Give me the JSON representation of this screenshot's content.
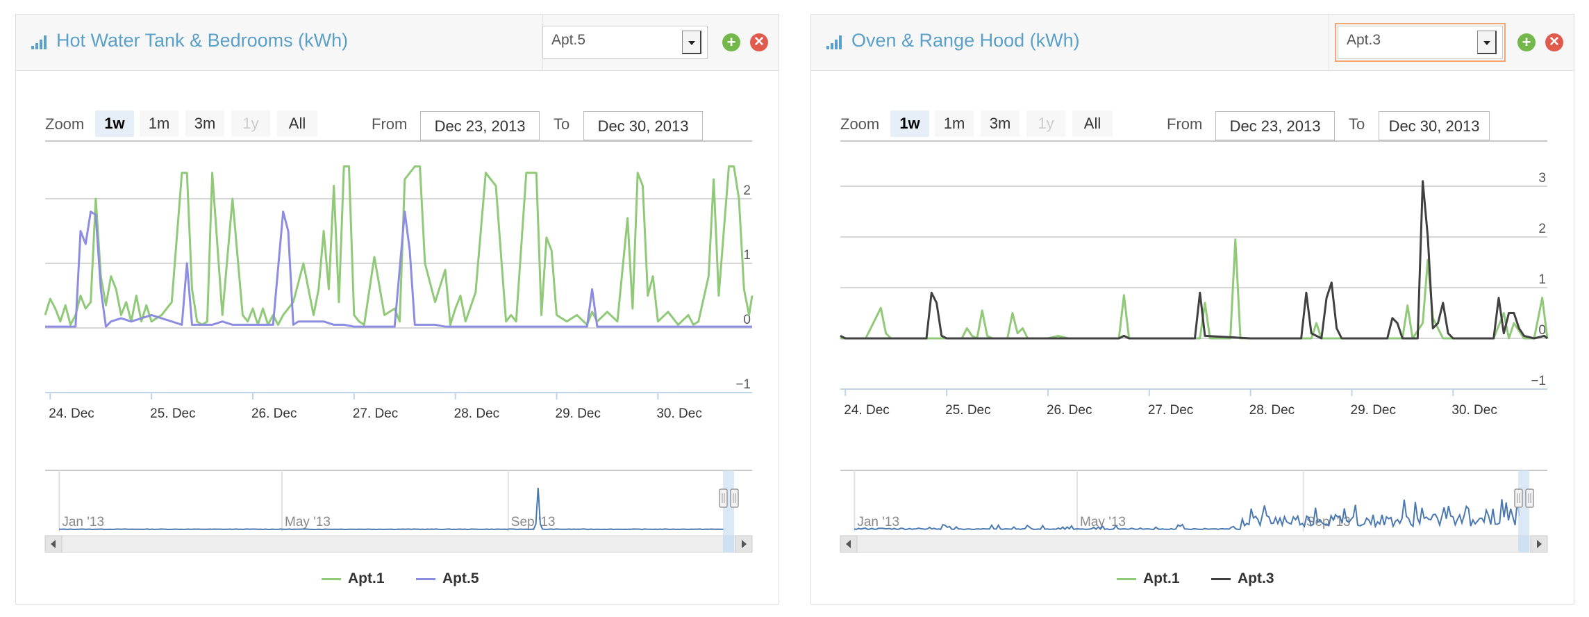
{
  "panels": [
    {
      "title": "Hot Water Tank & Bedrooms (kWh)",
      "apartment": "Apt.5",
      "zoom_label": "Zoom",
      "zoom_buttons": [
        "1w",
        "1m",
        "3m",
        "1y",
        "All"
      ],
      "zoom_active": "1w",
      "zoom_disabled": "1y",
      "from_label": "From",
      "from_date": "Dec 23, 2013",
      "to_label": "To",
      "to_date": "Dec 30, 2013"
    },
    {
      "title": "Oven & Range Hood (kWh)",
      "apartment": "Apt.3",
      "zoom_label": "Zoom",
      "zoom_buttons": [
        "1w",
        "1m",
        "3m",
        "1y",
        "All"
      ],
      "zoom_active": "1w",
      "zoom_disabled": "1y",
      "from_label": "From",
      "from_date": "Dec 23, 2013",
      "to_label": "To",
      "to_date": "Dec 30, 2013"
    }
  ],
  "chart_data": [
    {
      "type": "line",
      "x_unit": "days (Dec 2013)",
      "xlim": [
        23.95,
        30.93
      ],
      "ylim": [
        -1,
        3
      ],
      "yticks": [
        -1,
        0,
        1,
        2
      ],
      "xtick_labels": [
        "24. Dec",
        "25. Dec",
        "26. Dec",
        "27. Dec",
        "28. Dec",
        "29. Dec",
        "30. Dec"
      ],
      "xtick_values": [
        24,
        25,
        26,
        27,
        28,
        29,
        30
      ],
      "grid": true,
      "legend_position": "bottom-center",
      "series": [
        {
          "name": "Apt.1",
          "color": "#90c978",
          "x": [
            23.95,
            24.0,
            24.05,
            24.1,
            24.15,
            24.2,
            24.25,
            24.3,
            24.35,
            24.4,
            24.45,
            24.5,
            24.55,
            24.6,
            24.65,
            24.7,
            24.75,
            24.8,
            24.85,
            24.9,
            24.95,
            25.0,
            25.1,
            25.2,
            25.3,
            25.35,
            25.4,
            25.45,
            25.5,
            25.55,
            25.6,
            25.7,
            25.8,
            25.9,
            25.95,
            26.0,
            26.05,
            26.1,
            26.15,
            26.2,
            26.25,
            26.3,
            26.4,
            26.5,
            26.6,
            26.65,
            26.7,
            26.75,
            26.8,
            26.85,
            26.9,
            26.95,
            27.0,
            27.05,
            27.1,
            27.2,
            27.3,
            27.4,
            27.45,
            27.5,
            27.6,
            27.65,
            27.7,
            27.8,
            27.9,
            27.95,
            28.0,
            28.05,
            28.1,
            28.2,
            28.3,
            28.4,
            28.5,
            28.55,
            28.6,
            28.7,
            28.8,
            28.85,
            28.9,
            28.95,
            29.0,
            29.1,
            29.2,
            29.3,
            29.35,
            29.4,
            29.5,
            29.6,
            29.7,
            29.75,
            29.8,
            29.85,
            29.9,
            29.95,
            30.0,
            30.1,
            30.2,
            30.3,
            30.35,
            30.4,
            30.5,
            30.55,
            30.6,
            30.7,
            30.75,
            30.8,
            30.85,
            30.9,
            30.93
          ],
          "y": [
            0.2,
            0.45,
            0.3,
            0.1,
            0.35,
            0.05,
            0.2,
            0.5,
            0.3,
            0.4,
            2.0,
            0.8,
            0.35,
            0.8,
            0.6,
            0.2,
            0.4,
            0.1,
            0.5,
            0.1,
            0.35,
            0.1,
            0.2,
            0.4,
            2.4,
            2.4,
            0.6,
            0.1,
            0.05,
            0.1,
            2.4,
            0.2,
            2.0,
            0.2,
            0.1,
            0.3,
            0.05,
            0.3,
            0.05,
            0.2,
            0.05,
            0.2,
            0.4,
            1.0,
            0.2,
            0.6,
            1.5,
            0.6,
            2.2,
            0.4,
            2.5,
            2.5,
            0.2,
            0.1,
            0.05,
            1.1,
            0.2,
            0.3,
            0.1,
            2.3,
            2.5,
            2.5,
            1.0,
            0.4,
            0.9,
            0.05,
            0.3,
            0.5,
            0.1,
            0.55,
            2.4,
            2.2,
            0.1,
            0.2,
            0.1,
            2.4,
            2.4,
            0.2,
            1.4,
            1.2,
            0.2,
            0.1,
            0.2,
            0.05,
            0.25,
            0.1,
            0.25,
            0.1,
            1.7,
            0.3,
            2.4,
            2.2,
            0.5,
            0.8,
            0.1,
            0.25,
            0.05,
            0.2,
            0.05,
            0.1,
            0.8,
            2.3,
            0.5,
            2.5,
            2.5,
            2.0,
            0.6,
            0.2,
            0.5
          ]
        },
        {
          "name": "Apt.5",
          "color": "#8c8ce0",
          "x": [
            23.95,
            24.0,
            24.1,
            24.2,
            24.25,
            24.3,
            24.35,
            24.4,
            24.45,
            24.5,
            24.55,
            24.6,
            24.7,
            24.8,
            24.9,
            25.0,
            25.1,
            25.2,
            25.3,
            25.35,
            25.4,
            25.5,
            25.6,
            25.7,
            25.8,
            25.9,
            26.0,
            26.1,
            26.2,
            26.3,
            26.35,
            26.4,
            26.45,
            26.5,
            26.6,
            26.7,
            26.8,
            26.9,
            27.0,
            27.1,
            27.2,
            27.3,
            27.4,
            27.5,
            27.55,
            27.6,
            27.65,
            27.7,
            27.8,
            27.9,
            28.0,
            28.1,
            28.2,
            28.3,
            28.4,
            28.5,
            28.6,
            28.7,
            28.8,
            28.9,
            29.0,
            29.1,
            29.2,
            29.3,
            29.35,
            29.4,
            29.5,
            29.6,
            29.7,
            29.8,
            29.9,
            30.0,
            30.2,
            30.4,
            30.6,
            30.8,
            30.93
          ],
          "y": [
            0.02,
            0.02,
            0.02,
            0.02,
            0.02,
            1.5,
            1.3,
            1.8,
            1.75,
            0.6,
            0.02,
            0.1,
            0.15,
            0.1,
            0.15,
            0.2,
            0.15,
            0.1,
            0.05,
            1.0,
            0.05,
            0.05,
            0.05,
            0.1,
            0.05,
            0.05,
            0.05,
            0.05,
            0.05,
            1.8,
            1.5,
            0.05,
            0.1,
            0.1,
            0.1,
            0.1,
            0.05,
            0.05,
            0.02,
            0.02,
            0.02,
            0.02,
            0.02,
            1.8,
            1.2,
            0.05,
            0.05,
            0.05,
            0.05,
            0.02,
            0.02,
            0.02,
            0.02,
            0.02,
            0.02,
            0.02,
            0.02,
            0.02,
            0.02,
            0.02,
            0.02,
            0.02,
            0.02,
            0.02,
            0.6,
            0.02,
            0.02,
            0.02,
            0.02,
            0.02,
            0.02,
            0.02,
            0.02,
            0.02,
            0.02,
            0.02,
            0.02
          ]
        }
      ],
      "navigator": {
        "tick_labels": [
          "Jan '13",
          "May '13",
          "Sep '13"
        ],
        "color": "#4a78b0"
      }
    },
    {
      "type": "line",
      "x_unit": "days (Dec 2013)",
      "xlim": [
        23.95,
        30.93
      ],
      "ylim": [
        -1,
        4
      ],
      "yticks": [
        -1,
        0,
        1,
        2,
        3
      ],
      "xtick_labels": [
        "24. Dec",
        "25. Dec",
        "26. Dec",
        "27. Dec",
        "28. Dec",
        "29. Dec",
        "30. Dec"
      ],
      "xtick_values": [
        24,
        25,
        26,
        27,
        28,
        29,
        30
      ],
      "grid": true,
      "legend_position": "bottom-center",
      "series": [
        {
          "name": "Apt.1",
          "color": "#90c978",
          "x": [
            23.95,
            24.2,
            24.35,
            24.4,
            24.45,
            24.6,
            25.0,
            25.15,
            25.2,
            25.25,
            25.3,
            25.35,
            25.4,
            25.45,
            25.6,
            25.65,
            25.7,
            25.75,
            25.8,
            26.0,
            26.1,
            26.2,
            26.5,
            26.7,
            26.75,
            26.8,
            26.9,
            27.0,
            27.5,
            27.55,
            27.6,
            27.65,
            27.8,
            27.85,
            27.9,
            28.5,
            28.6,
            28.65,
            28.7,
            28.8,
            29.5,
            29.55,
            29.6,
            29.7,
            29.75,
            29.8,
            29.85,
            29.9,
            30.4,
            30.5,
            30.55,
            30.6,
            30.7,
            30.8,
            30.88,
            30.93
          ],
          "y": [
            0,
            0,
            0.6,
            0.1,
            0,
            0,
            0,
            0,
            0.2,
            0.05,
            0,
            0.55,
            0.05,
            0,
            0,
            0.5,
            0.1,
            0.2,
            0,
            0,
            0.05,
            0,
            0,
            0,
            0.85,
            0,
            0,
            0,
            0,
            0.7,
            0,
            0,
            0,
            1.95,
            0,
            0,
            0,
            0.3,
            0,
            0,
            0,
            0.65,
            0,
            0.3,
            1.55,
            0.4,
            0.2,
            0,
            0,
            0.5,
            0,
            0.3,
            0,
            0,
            0.8,
            0
          ]
        },
        {
          "name": "Apt.3",
          "color": "#404040",
          "x": [
            23.95,
            24.0,
            24.5,
            24.8,
            24.85,
            24.9,
            24.95,
            25.0,
            26.0,
            26.7,
            26.75,
            26.8,
            27.0,
            27.45,
            27.5,
            27.55,
            28.0,
            28.5,
            28.55,
            28.6,
            28.7,
            28.75,
            28.8,
            28.85,
            28.9,
            29.0,
            29.35,
            29.4,
            29.45,
            29.5,
            29.65,
            29.7,
            29.75,
            29.8,
            29.85,
            29.9,
            29.95,
            30.0,
            30.4,
            30.45,
            30.5,
            30.55,
            30.6,
            30.65,
            30.7,
            30.8,
            30.9,
            30.93
          ],
          "y": [
            0.05,
            0,
            0,
            0,
            0.9,
            0.7,
            0.05,
            0,
            0,
            0,
            0.05,
            0,
            0,
            0,
            0.9,
            0.05,
            0,
            0,
            0.9,
            0.1,
            0,
            0.8,
            1.1,
            0.2,
            0,
            0,
            0,
            0.4,
            0.3,
            0,
            0,
            3.1,
            2.0,
            0.2,
            0.3,
            0.7,
            0.1,
            0,
            0,
            0.8,
            0.1,
            0.5,
            0.5,
            0.2,
            0.05,
            0,
            0.05,
            0
          ]
        }
      ],
      "navigator": {
        "tick_labels": [
          "Jan '13",
          "May '13",
          "Sep '13"
        ],
        "color": "#4a78b0"
      }
    }
  ]
}
